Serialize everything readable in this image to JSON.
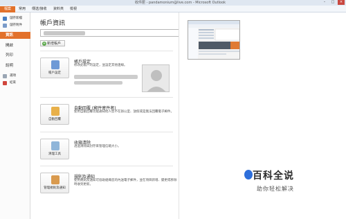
{
  "window": {
    "title": "收件匣 - pandamonium@live.com - Microsoft Outlook",
    "buttons": [
      "–",
      "□",
      "×"
    ]
  },
  "ribbon": {
    "tabs": [
      "檔案",
      "常用",
      "傳送/接收",
      "資料夾",
      "檢視"
    ]
  },
  "nav": {
    "items": [
      {
        "label": "儲存新檔",
        "icon": "save-icon"
      },
      {
        "label": "儲存附件",
        "icon": "attachment-icon"
      },
      {
        "label": "資訊",
        "icon": "",
        "active": true
      },
      {
        "label": "開啟",
        "icon": ""
      },
      {
        "label": "列印",
        "icon": ""
      },
      {
        "label": "說明",
        "icon": ""
      },
      {
        "label": "選項",
        "icon": "options-icon"
      },
      {
        "label": "結束",
        "icon": "exit-icon"
      }
    ]
  },
  "main": {
    "heading": "帳戶資訊",
    "add_account": "新增帳戶",
    "sections": [
      {
        "button": "帳戶設定",
        "title": "帳戶設定",
        "desc": "修改此帳戶的設定，並設定其他連線。"
      },
      {
        "button": "自動回覆",
        "title": "自動回覆 (郵件寄件者)",
        "desc": "使用自動回覆功能通知他人您不在辦公室、放假或是無法回覆電子郵件。"
      },
      {
        "button": "清理工具",
        "title": "收箱清除",
        "desc": "透過清除與封存來管理信箱大小。"
      },
      {
        "button": "管理規則及通知",
        "title": "規則及通知",
        "desc": "使用規則及通知可協助組織您的內送電子郵件，並在項目新增、變更或移除時收到更新。"
      }
    ]
  },
  "watermark": {
    "title": "百科全说",
    "subtitle": "助你轻松解决"
  },
  "colors": {
    "file_tab": "#e2712b",
    "active_nav": "#e2712b",
    "watermark_blue": "#2e6fdb"
  }
}
